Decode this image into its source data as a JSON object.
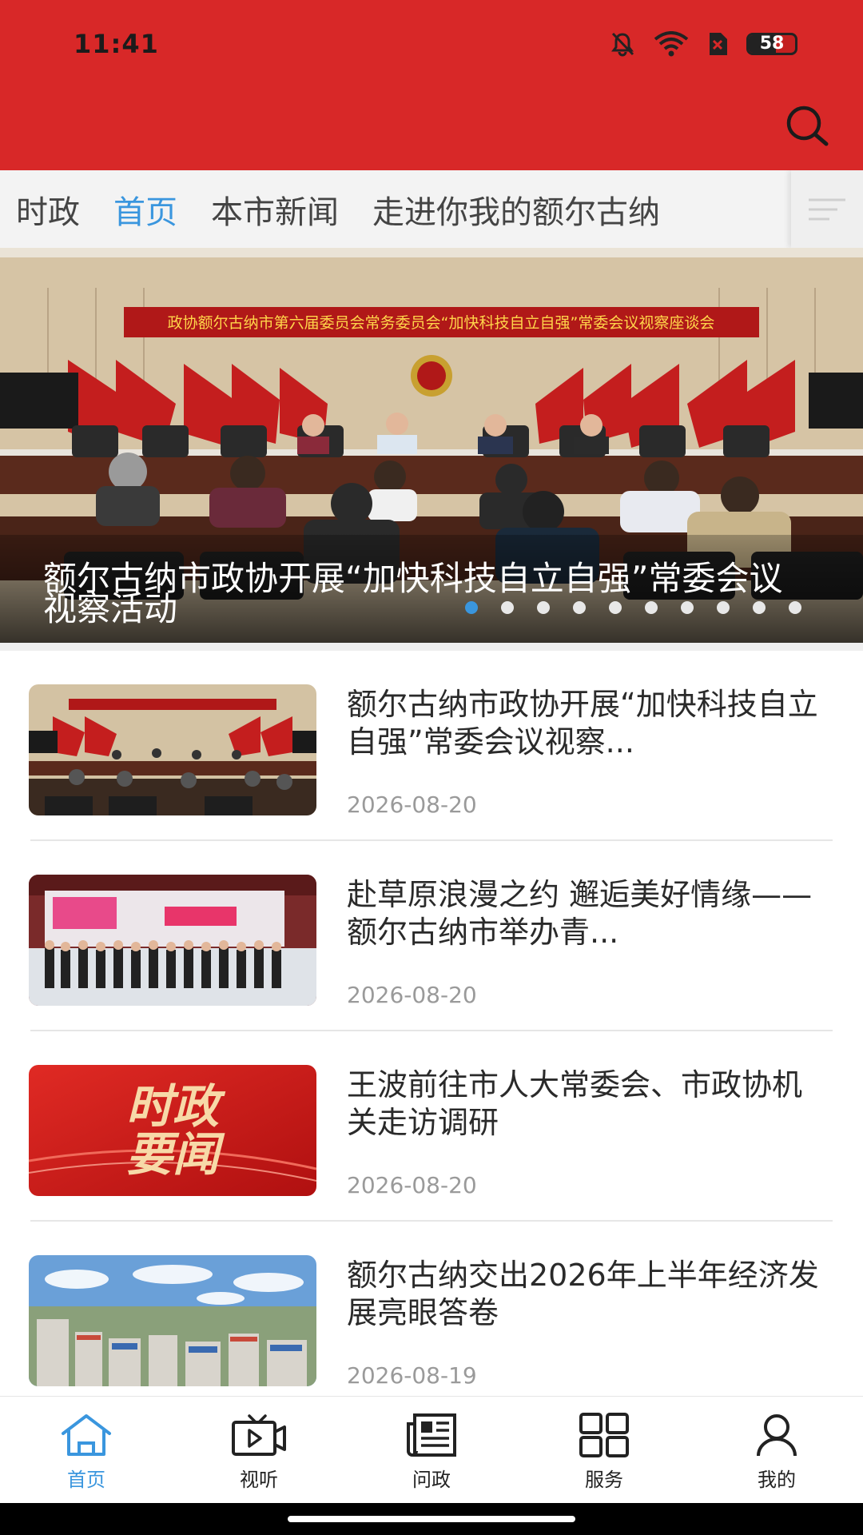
{
  "status": {
    "time": "11:41",
    "battery": "58"
  },
  "header": {
    "search_icon": "search-icon"
  },
  "tabs": [
    {
      "label": "时政",
      "active": false
    },
    {
      "label": "首页",
      "active": true
    },
    {
      "label": "本市新闻",
      "active": false
    },
    {
      "label": "走进你我的额尔古纳",
      "active": false
    }
  ],
  "banner": {
    "headline": "额尔古纳市政协开展“加快科技自立自强”常委会议视察活动",
    "photo_banner_text": "政协额尔古纳市第六届委员会常务委员会“加快科技自立自强”常委会议视察座谈会",
    "slide_count": 10,
    "active_slide": 1
  },
  "news": [
    {
      "title": "额尔古纳市政协开展“加快科技自立自强”常委会议视察...",
      "date": "2026-08-20",
      "thumb": "meeting"
    },
    {
      "title": "赴草原浪漫之约 邂逅美好情缘——额尔古纳市举办青...",
      "date": "2026-08-20",
      "thumb": "group"
    },
    {
      "title": "王波前往市人大常委会、市政协机关走访调研",
      "date": "2026-08-20",
      "thumb": "red",
      "thumb_text_1": "时政",
      "thumb_text_2": "要闻"
    },
    {
      "title": "额尔古纳交出2026年上半年经济发展亮眼答卷",
      "date": "2026-08-19",
      "thumb": "city"
    }
  ],
  "nav": [
    {
      "label": "首页",
      "icon": "home-icon",
      "active": true
    },
    {
      "label": "视听",
      "icon": "video-icon",
      "active": false
    },
    {
      "label": "问政",
      "icon": "newspaper-icon",
      "active": false
    },
    {
      "label": "服务",
      "icon": "grid-icon",
      "active": false
    },
    {
      "label": "我的",
      "icon": "user-icon",
      "active": false
    }
  ],
  "colors": {
    "header_red": "#d82828",
    "accent_blue": "#3a96de"
  }
}
